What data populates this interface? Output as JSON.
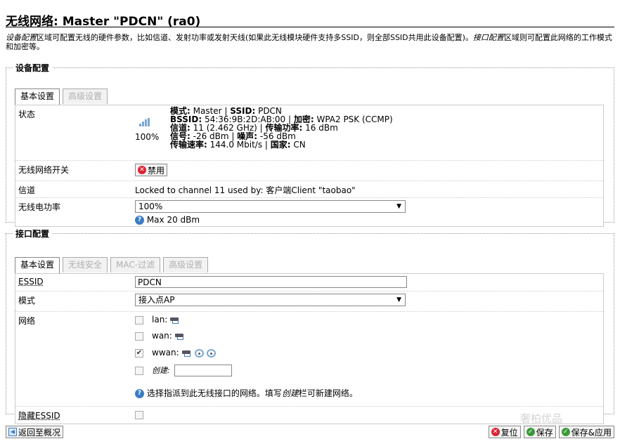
{
  "page": {
    "title": "无线网络: Master \"PDCN\" (ra0)",
    "description_part1": "设备配置",
    "description_part2": "区域可配置无线的硬件参数，比如信道、发射功率或发射天线(如果此无线模块硬件支持多SSID，则全部SSID共用此设备配置)。",
    "description_part3": "接口配置",
    "description_part4": "区域则可配置此网络的工作模式和加密等。"
  },
  "device_config": {
    "legend": "设备配置",
    "tabs": [
      {
        "label": "基本设置",
        "active": true
      },
      {
        "label": "高级设置",
        "active": false
      }
    ],
    "status": {
      "label": "状态",
      "signal_percent": "100%",
      "line1_k1": "模式:",
      "line1_v1": " Master | ",
      "line1_k2": "SSID:",
      "line1_v2": " PDCN",
      "line2_k1": "BSSID:",
      "line2_v1": " 54:36:9B:2D:AB:00 | ",
      "line2_k2": "加密:",
      "line2_v2": " WPA2 PSK (CCMP)",
      "line3_k1": "信道:",
      "line3_v1": " 11 (2.462 GHz) | ",
      "line3_k2": "传输功率:",
      "line3_v2": " 16 dBm",
      "line4_k1": "信号:",
      "line4_v1": " -26 dBm | ",
      "line4_k2": "噪声:",
      "line4_v2": " -56 dBm",
      "line5_k1": "传输速率:",
      "line5_v1": " 144.0 Mbit/s | ",
      "line5_k2": "国家:",
      "line5_v2": " CN"
    },
    "wireless_switch": {
      "label": "无线网络开关",
      "button": "禁用"
    },
    "channel": {
      "label": "信道",
      "value": "Locked to channel 11 used by: 客户端Client \"taobao\""
    },
    "tx_power": {
      "label": "无线电功率",
      "selected": "100%",
      "hint": "Max 20 dBm"
    }
  },
  "interface_config": {
    "legend": "接口配置",
    "tabs": [
      {
        "label": "基本设置",
        "active": true
      },
      {
        "label": "无线安全",
        "active": false
      },
      {
        "label": "MAC-过滤",
        "active": false
      },
      {
        "label": "高级设置",
        "active": false
      }
    ],
    "essid": {
      "label": "ESSID",
      "value": "PDCN"
    },
    "mode": {
      "label": "模式",
      "selected": "接入点AP"
    },
    "network": {
      "label": "网络",
      "options": [
        {
          "name": "lan:",
          "checked": false
        },
        {
          "name": "wan:",
          "checked": false
        },
        {
          "name": "wwan:",
          "checked": true
        }
      ],
      "create_label": "创建:",
      "hint_part1": "选择指派到此无线接口的网络。填写",
      "hint_em": "创建",
      "hint_part2": "栏可新建网络。"
    },
    "hide_essid": {
      "label": "隐藏ESSID",
      "checked": false
    }
  },
  "footer": {
    "back": "返回至概况",
    "reset": "复位",
    "save": "保存",
    "save_apply": "保存&应用"
  },
  "watermark": "奢柏优品"
}
